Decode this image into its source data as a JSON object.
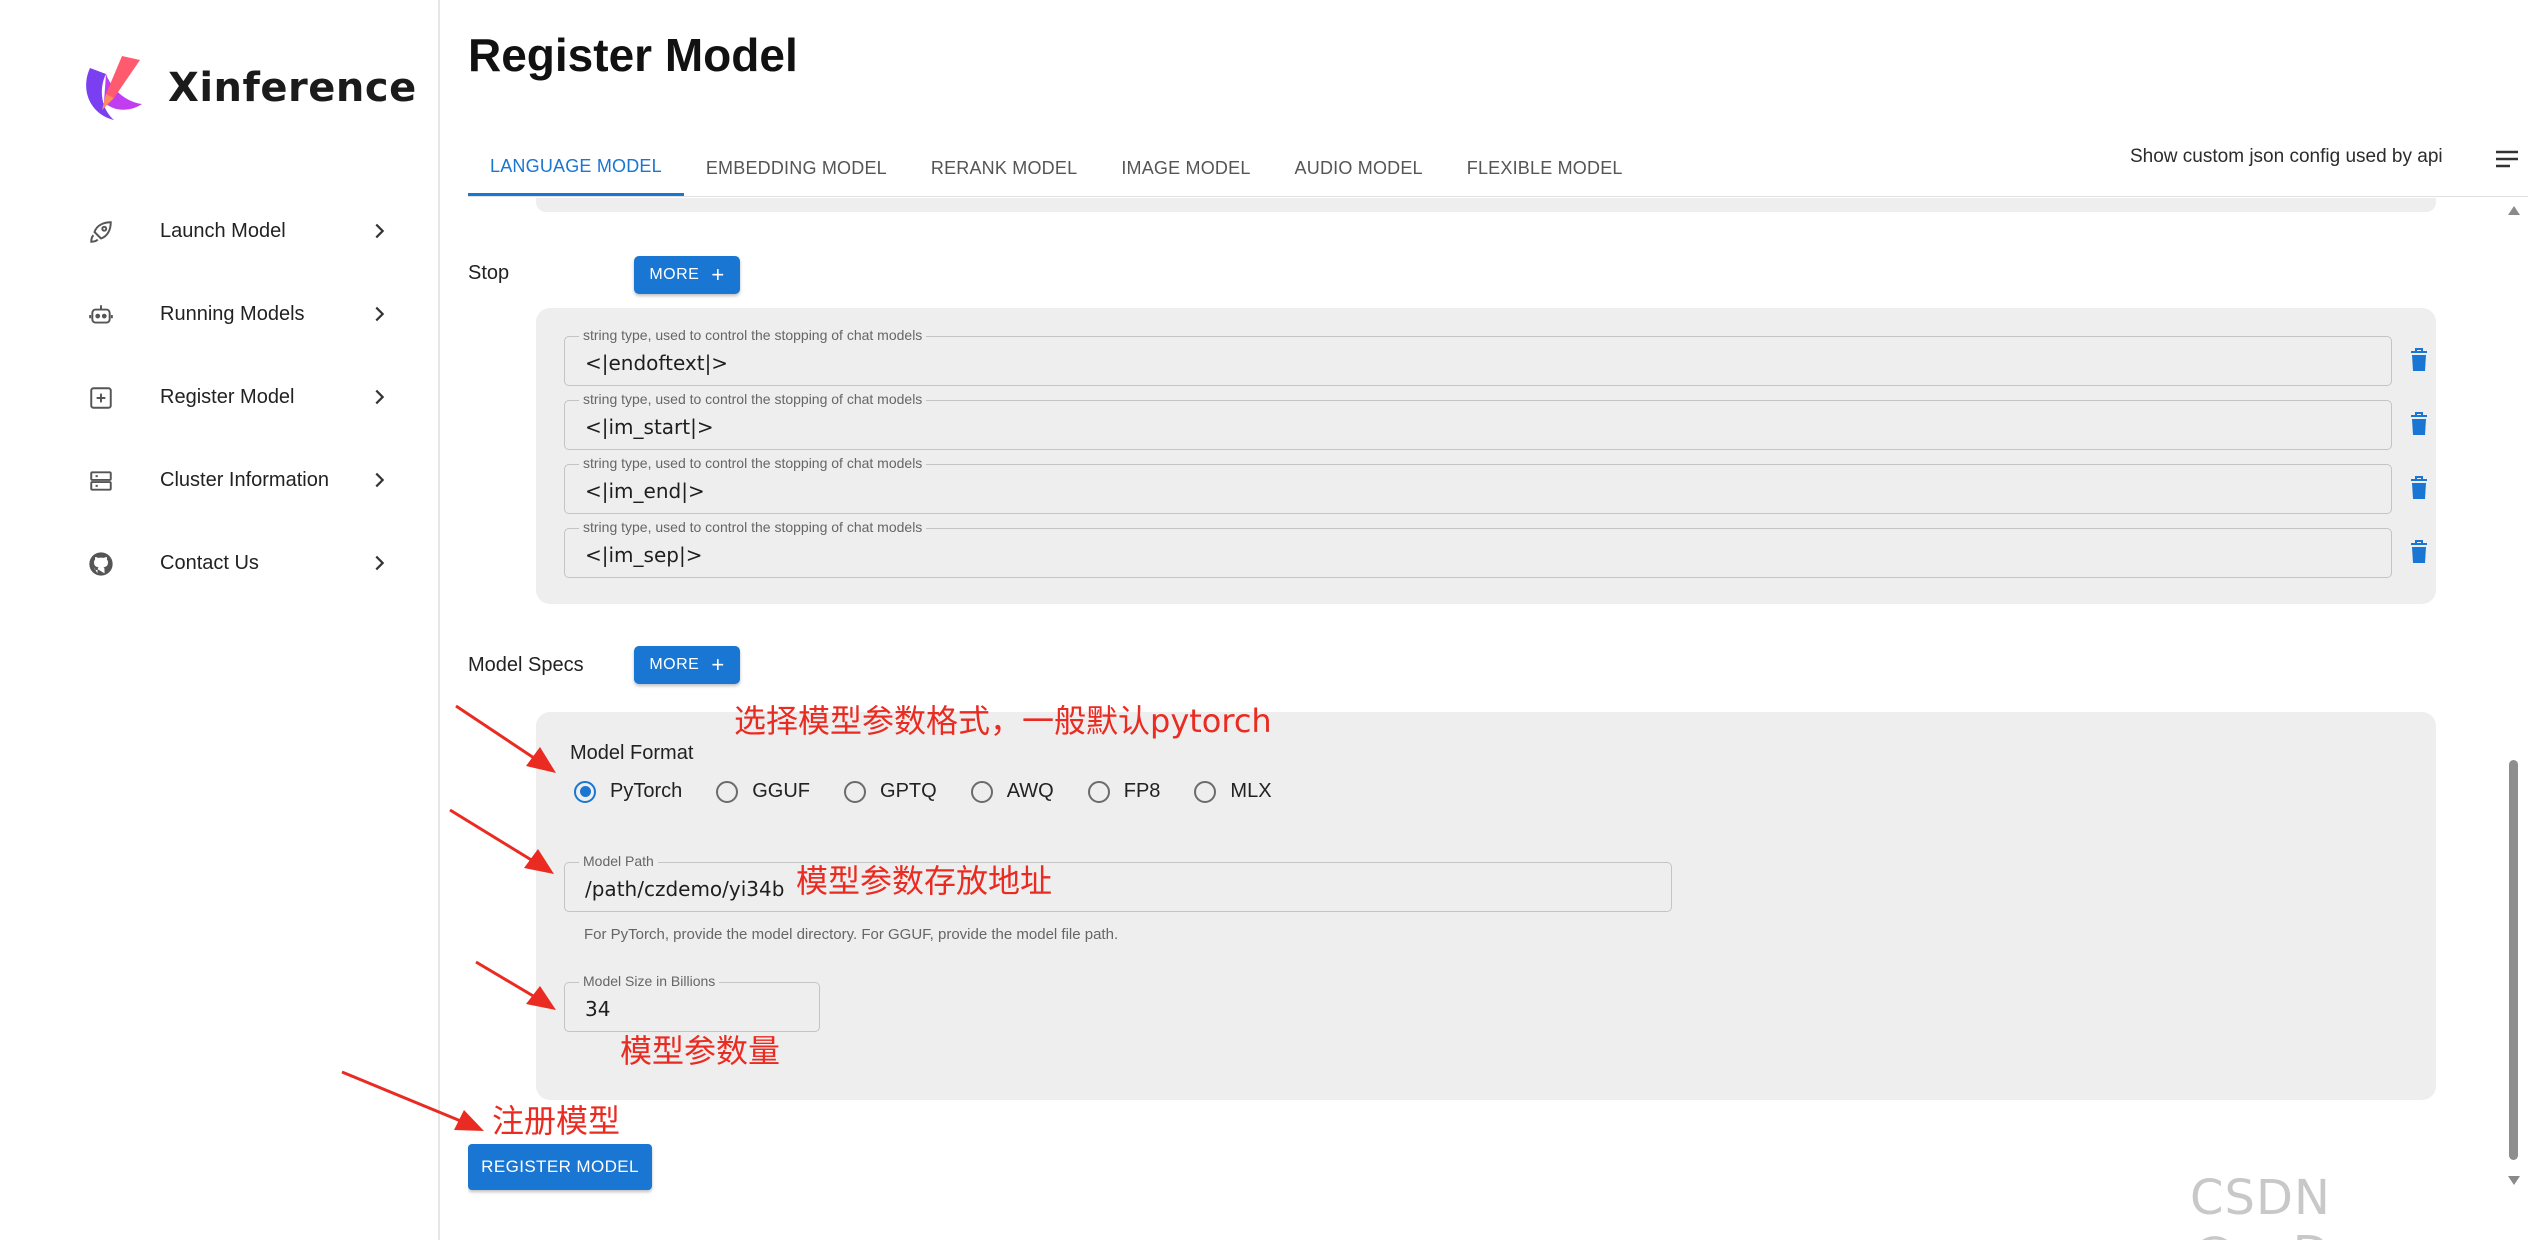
{
  "app": {
    "name": "Xinference"
  },
  "sidebar": {
    "items": [
      {
        "label": "Launch Model",
        "icon": "rocket-icon"
      },
      {
        "label": "Running Models",
        "icon": "robot-icon"
      },
      {
        "label": "Register Model",
        "icon": "plus-square-icon"
      },
      {
        "label": "Cluster Information",
        "icon": "server-icon"
      },
      {
        "label": "Contact Us",
        "icon": "github-icon"
      }
    ]
  },
  "header": {
    "title": "Register Model",
    "tabs": [
      {
        "label": "LANGUAGE MODEL",
        "active": true
      },
      {
        "label": "EMBEDDING MODEL"
      },
      {
        "label": "RERANK MODEL"
      },
      {
        "label": "IMAGE MODEL"
      },
      {
        "label": "AUDIO MODEL"
      },
      {
        "label": "FLEXIBLE MODEL"
      }
    ],
    "json_toggle_label": "Show custom json config used by api"
  },
  "stop": {
    "label": "Stop",
    "more_label": "MORE",
    "fields": [
      {
        "legend": "string type, used to control the stopping of chat models",
        "value": "<|endoftext|>"
      },
      {
        "legend": "string type, used to control the stopping of chat models",
        "value": "<|im_start|>"
      },
      {
        "legend": "string type, used to control the stopping of chat models",
        "value": "<|im_end|>"
      },
      {
        "legend": "string type, used to control the stopping of chat models",
        "value": "<|im_sep|>"
      }
    ]
  },
  "model_specs": {
    "label": "Model Specs",
    "more_label": "MORE",
    "format_label": "Model Format",
    "formats": [
      {
        "label": "PyTorch",
        "checked": true
      },
      {
        "label": "GGUF"
      },
      {
        "label": "GPTQ"
      },
      {
        "label": "AWQ"
      },
      {
        "label": "FP8"
      },
      {
        "label": "MLX"
      }
    ],
    "path": {
      "legend": "Model Path",
      "value": "/path/czdemo/yi34b",
      "helper": "For PyTorch, provide the model directory. For GGUF, provide the model file path."
    },
    "size": {
      "legend": "Model Size in Billions",
      "value": "34"
    }
  },
  "register_button_label": "REGISTER MODEL",
  "annotations": {
    "format": "选择模型参数格式，一般默认pytorch",
    "path": "模型参数存放地址",
    "size": "模型参数量",
    "register": "注册模型"
  },
  "watermark": "CSDN @czDemo",
  "colors": {
    "accent": "#1976d2",
    "annotation": "#ea2b22",
    "panel": "#eeeeee"
  }
}
